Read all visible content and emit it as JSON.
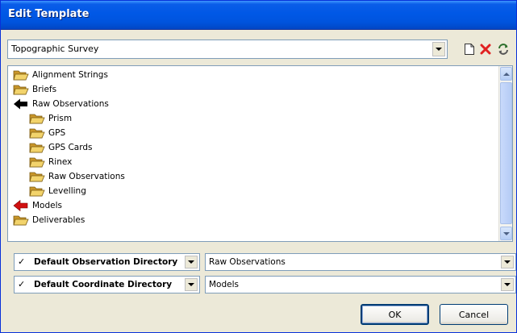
{
  "window": {
    "title": "Edit Template"
  },
  "template": {
    "selected": "Topographic Survey",
    "tools": [
      "new-document-icon",
      "delete-icon",
      "refresh-icon"
    ]
  },
  "tree": {
    "items": [
      {
        "label": "Alignment Strings",
        "icon": "folder-open-icon",
        "level": 0
      },
      {
        "label": "Briefs",
        "icon": "folder-open-icon",
        "level": 0
      },
      {
        "label": "Raw Observations",
        "icon": "black-arrow-icon",
        "level": 0
      },
      {
        "label": "Prism",
        "icon": "folder-open-icon",
        "level": 1
      },
      {
        "label": "GPS",
        "icon": "folder-open-icon",
        "level": 1
      },
      {
        "label": "GPS Cards",
        "icon": "folder-open-icon",
        "level": 1
      },
      {
        "label": "Rinex",
        "icon": "folder-open-icon",
        "level": 1
      },
      {
        "label": "Raw Observations",
        "icon": "folder-open-icon",
        "level": 1
      },
      {
        "label": "Levelling",
        "icon": "folder-open-icon",
        "level": 1
      },
      {
        "label": "Models",
        "icon": "red-arrow-icon",
        "level": 0
      },
      {
        "label": "Deliverables",
        "icon": "folder-open-icon",
        "level": 0
      }
    ]
  },
  "directories": [
    {
      "check": "✓",
      "label": "Default Observation Directory",
      "value": "Raw Observations"
    },
    {
      "check": "✓",
      "label": "Default Coordinate Directory",
      "value": "Models"
    }
  ],
  "buttons": {
    "ok": "OK",
    "cancel": "Cancel"
  },
  "colors": {
    "titlebar": "#0054e3",
    "window_bg": "#ece9d8",
    "folder": "#d9b13a",
    "delete_red": "#e02020",
    "arrow_red": "#d01010"
  }
}
